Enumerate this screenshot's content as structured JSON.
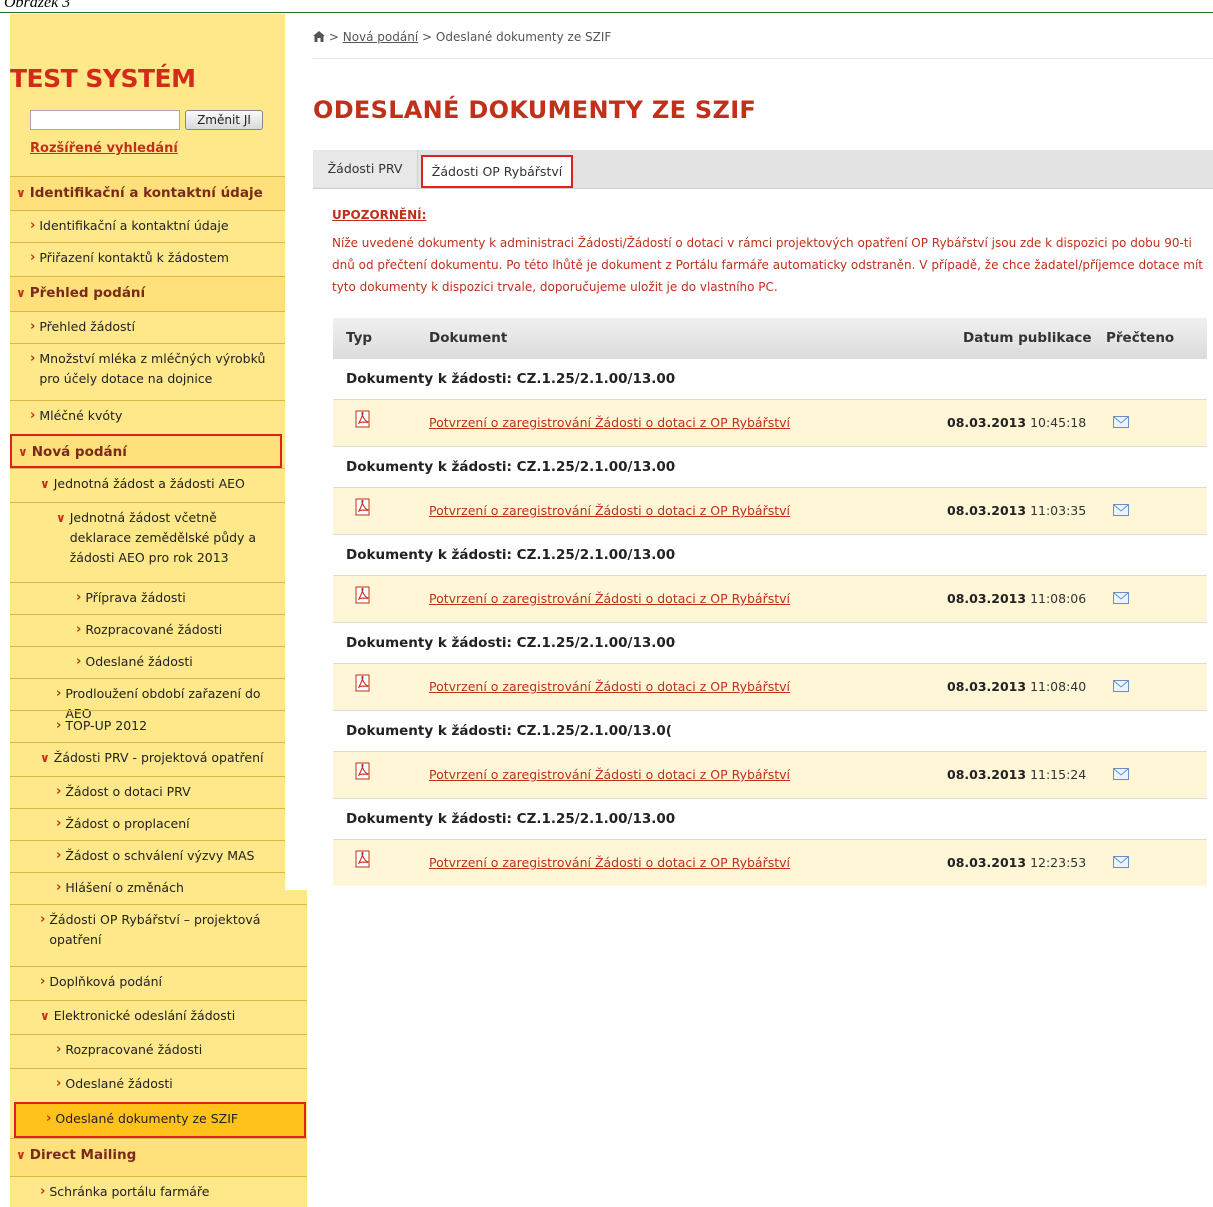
{
  "caption": "Obrázek 3",
  "site_title": "TEST SYSTÉM",
  "search": {
    "value": "",
    "button": "Změnit JI",
    "advanced": "Rozšířené vyhledání"
  },
  "sidebar": [
    {
      "label": "Identifikační a kontaktní údaje",
      "kind": "head"
    },
    {
      "label": "Identifikační a kontaktní údaje",
      "kind": "item"
    },
    {
      "label": "Přiřazení kontaktů k žádostem",
      "kind": "item"
    },
    {
      "label": "Přehled podání",
      "kind": "head"
    },
    {
      "label": "Přehled žádostí",
      "kind": "item"
    },
    {
      "label": "Množství mléka z mléčných výrobků pro účely dotace na dojnice",
      "kind": "item"
    },
    {
      "label": "Mléčné kvóty",
      "kind": "item"
    },
    {
      "label": "Nová podání",
      "kind": "head"
    },
    {
      "label": "Jednotná žádost a žádosti AEO",
      "kind": "item"
    },
    {
      "label": "Jednotná žádost včetně deklarace zemědělské půdy a žádosti AEO pro rok 2013",
      "kind": "item"
    },
    {
      "label": "Příprava žádosti",
      "kind": "item"
    },
    {
      "label": "Rozpracované žádosti",
      "kind": "item"
    },
    {
      "label": "Odeslané žádosti",
      "kind": "item"
    },
    {
      "label": "Prodloužení období zařazení do AEO",
      "kind": "item"
    },
    {
      "label": "TOP-UP 2012",
      "kind": "item"
    },
    {
      "label": "Žádosti PRV - projektová opatření",
      "kind": "item"
    },
    {
      "label": "Žádost o dotaci PRV",
      "kind": "item"
    },
    {
      "label": "Žádost o proplacení",
      "kind": "item"
    },
    {
      "label": "Žádost o schválení výzvy MAS",
      "kind": "item"
    },
    {
      "label": "Hlášení o změnách",
      "kind": "item"
    },
    {
      "label": "Žádosti OP Rybářství – projektová opatření",
      "kind": "item"
    },
    {
      "label": "Doplňková podání",
      "kind": "item"
    },
    {
      "label": "Elektronické odeslání žádosti",
      "kind": "item"
    },
    {
      "label": "Rozpracované žádosti",
      "kind": "item"
    },
    {
      "label": "Odeslané žádosti",
      "kind": "item"
    },
    {
      "label": "Odeslané dokumenty ze SZIF",
      "kind": "item"
    },
    {
      "label": "Direct Mailing",
      "kind": "head"
    },
    {
      "label": "Schránka portálu farmáře",
      "kind": "item"
    }
  ],
  "breadcrumb": {
    "link": "Nová podání",
    "current": "Odeslané dokumenty ze SZIF",
    "sep": ">"
  },
  "page_title": "ODESLANÉ DOKUMENTY ZE SZIF",
  "tabs": [
    {
      "label": "Žádosti PRV"
    },
    {
      "label": "Žádosti OP Rybářství"
    }
  ],
  "warning": {
    "title": "UPOZORNĚNÍ:",
    "text": "Níže uvedené dokumenty k administraci Žádosti/Žádostí o dotaci v rámci projektových opatření OP Rybářství jsou zde k dispozici po dobu 90-ti dnů od přečtení dokumentu. Po této lhůtě je dokument z Portálu farmáře automaticky odstraněn. V případě, že chce žadatel/příjemce dotace mít tyto dokumenty k dispozici trvale, doporučujeme uložit je do vlastního PC."
  },
  "table": {
    "headers": {
      "type": "Typ",
      "document": "Dokument",
      "date": "Datum publikace",
      "read": "Přečteno"
    },
    "groups": [
      {
        "title": "Dokumenty k žádosti: CZ.1.25/2.1.00/13.00",
        "doc": "Potvrzení o zaregistrování Žádosti o dotaci z OP Rybářství",
        "date": "08.03.2013",
        "time": "10:45:18"
      },
      {
        "title": "Dokumenty k žádosti: CZ.1.25/2.1.00/13.00",
        "doc": "Potvrzení o zaregistrování Žádosti o dotaci z OP Rybářství",
        "date": "08.03.2013",
        "time": "11:03:35"
      },
      {
        "title": "Dokumenty k žádosti: CZ.1.25/2.1.00/13.00",
        "doc": "Potvrzení o zaregistrování Žádosti o dotaci z OP Rybářství",
        "date": "08.03.2013",
        "time": "11:08:06"
      },
      {
        "title": "Dokumenty k žádosti: CZ.1.25/2.1.00/13.00",
        "doc": "Potvrzení o zaregistrování Žádosti o dotaci z OP Rybářství",
        "date": "08.03.2013",
        "time": "11:08:40"
      },
      {
        "title": "Dokumenty k žádosti: CZ.1.25/2.1.00/13.0(",
        "doc": "Potvrzení o zaregistrování Žádosti o dotaci z OP Rybářství",
        "date": "08.03.2013",
        "time": "11:15:24"
      },
      {
        "title": "Dokumenty k žádosti: CZ.1.25/2.1.00/13.00",
        "doc": "Potvrzení o zaregistrování Žádosti o dotaci z OP Rybářství",
        "date": "08.03.2013",
        "time": "12:23:53"
      }
    ]
  },
  "colors": {
    "accent": "#c0301a",
    "sidebar": "#ffe88a",
    "highlight": "#e01f1f",
    "active": "#ffc21a"
  }
}
